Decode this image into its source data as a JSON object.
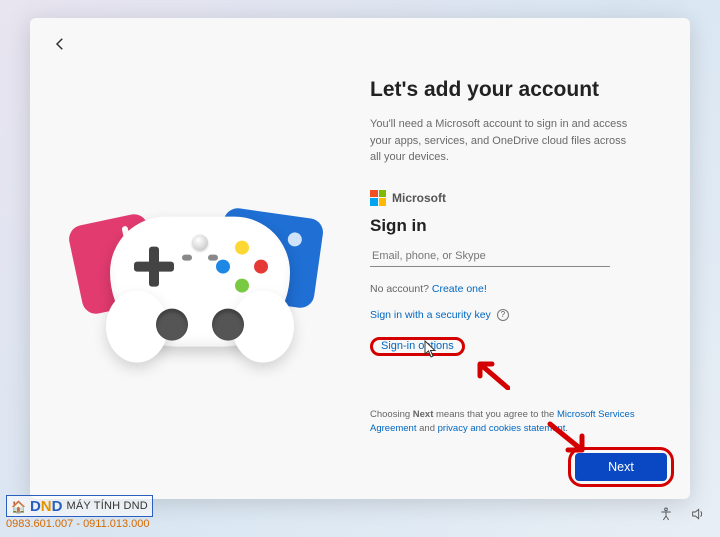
{
  "header": {
    "title": "Let's add your account",
    "description": "You'll need a Microsoft account to sign in and access your apps, services, and OneDrive cloud files across all your devices."
  },
  "brand": {
    "name": "Microsoft"
  },
  "signin": {
    "heading": "Sign in",
    "placeholder": "Email, phone, or Skype",
    "no_account_text": "No account?",
    "create_link": "Create one!",
    "security_key_text": "Sign in with a security key",
    "options_link": "Sign-in options"
  },
  "legal": {
    "prefix": "Choosing ",
    "bold": "Next",
    "mid": " means that you agree to the ",
    "link1": "Microsoft Services Agreement",
    "and": " and ",
    "link2": "privacy and cookies statement",
    "suffix": "."
  },
  "buttons": {
    "next": "Next"
  },
  "watermark": {
    "brand": "DND",
    "text": "MÁY TÍNH DND",
    "phones": "0983.601.007 - 0911.013.000"
  }
}
